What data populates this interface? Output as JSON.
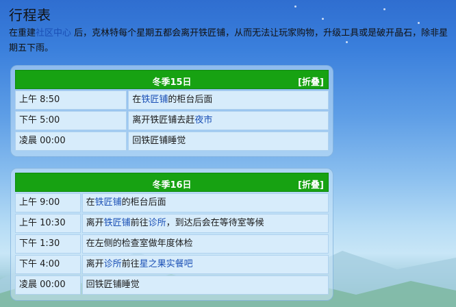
{
  "title": "行程表",
  "intro": {
    "part1": "在重建",
    "link1": "社区中心",
    "part2": "后，克林特每个星期五都会离开铁匠铺，从而无法让玩家购物，升级工具或是破开晶石，除非星期五下雨。"
  },
  "colors": {
    "header_green": "#17a212",
    "link_blue": "#1a4fb5",
    "cell_bg": "#d7ecfb"
  },
  "schedules": [
    {
      "title": "冬季15日",
      "collapse_label": "[折叠]",
      "rows": [
        {
          "time": "上午 8:50",
          "pre": "在",
          "link": "铁匠铺",
          "post": "的柜台后面"
        },
        {
          "time": "下午 5:00",
          "pre": "离开铁匠铺去赶",
          "link": "夜市",
          "post": ""
        },
        {
          "time": "凌晨 00:00",
          "pre": "回铁匠铺睡觉",
          "link": "",
          "post": ""
        }
      ]
    },
    {
      "title": "冬季16日",
      "collapse_label": "[折叠]",
      "rows": [
        {
          "time": "上午 9:00",
          "pre": "在",
          "link": "铁匠铺",
          "post": "的柜台后面"
        },
        {
          "time": "上午 10:30",
          "pre": "离开",
          "link": "铁匠铺",
          "mid": "前往",
          "link2": "诊所",
          "post": "，到达后会在等待室等候"
        },
        {
          "time": "下午 1:30",
          "pre": "在左侧的检查室做年度体检",
          "link": "",
          "post": ""
        },
        {
          "time": "下午 4:00",
          "pre": "离开",
          "link": "诊所",
          "mid": "前往",
          "link2": "星之果实餐吧",
          "post": ""
        },
        {
          "time": "凌晨 00:00",
          "pre": "回铁匠铺睡觉",
          "link": "",
          "post": ""
        }
      ]
    }
  ]
}
